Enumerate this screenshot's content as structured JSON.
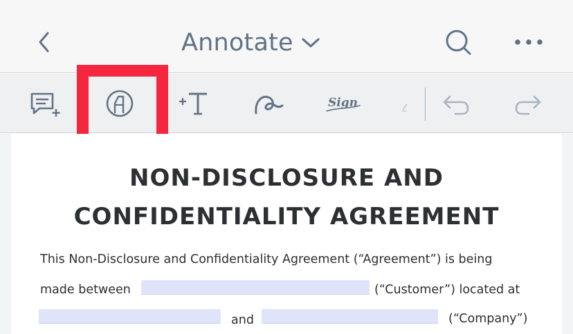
{
  "header": {
    "title": "Annotate"
  },
  "toolbar": {
    "sign_label": "Sign"
  },
  "document": {
    "title_line1": "NON-DISCLOSURE AND",
    "title_line2": "CONFIDENTIALITY AGREEMENT",
    "para_line1": "This Non-Disclosure and Confidentiality Agreement (“Agreement”) is being",
    "para_line2_start": "made between",
    "para_line2_end": "(“Customer”) located at",
    "para_line3_mid": "and",
    "para_line3_end": "(“Company”)"
  },
  "colors": {
    "icon": "#5f7385",
    "callout": "#f4273f",
    "field_fill": "#dfe4fb"
  },
  "icons": [
    "chevron-left-icon",
    "chevron-down-icon",
    "search-icon",
    "more-horizontal-icon",
    "comment-add-icon",
    "highlighter-icon",
    "add-text-icon",
    "freehand-draw-icon",
    "signature-icon",
    "eraser-icon",
    "undo-icon",
    "redo-icon"
  ]
}
